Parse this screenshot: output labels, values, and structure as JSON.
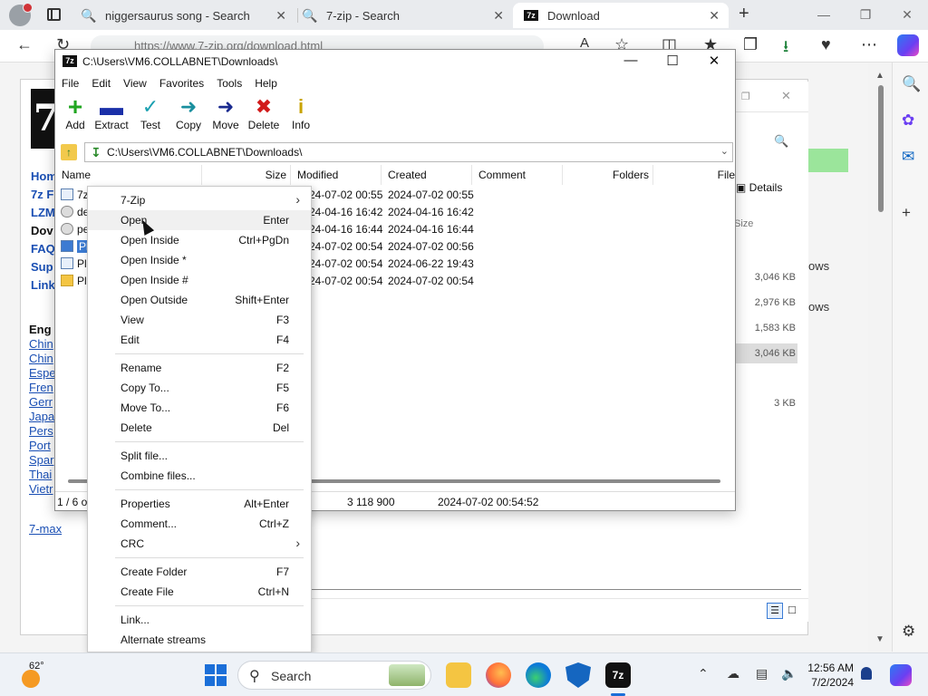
{
  "browser": {
    "tabs": [
      {
        "title": "niggersaurus song - Search",
        "icon": "bing-search-icon"
      },
      {
        "title": "7-zip - Search",
        "icon": "bing-search-icon"
      },
      {
        "title": "Download",
        "icon": "7zip-icon"
      }
    ],
    "url": "https://www.7-zip.org/download.html"
  },
  "webpage": {
    "nav": [
      "Hom",
      "7z F",
      "LZM",
      "Dov",
      "FAQ",
      "Sup",
      "Link"
    ],
    "lang_heading": "Eng",
    "languages": [
      "Chin",
      "Chin",
      "Espe",
      "Fren",
      "Gerr",
      "Japa",
      "Pers",
      "Port",
      "Spar",
      "Thai",
      "Vietr"
    ],
    "seven_max": "7-max"
  },
  "explorer_bg": {
    "details_label": "Details",
    "size_header": "Size",
    "sizes": [
      "3,046 KB",
      "2,976 KB",
      "1,583 KB",
      "3,046 KB",
      "3 KB"
    ],
    "row_fragments": [
      "ows",
      "ows"
    ]
  },
  "sevenzip": {
    "title": "C:\\Users\\VM6.COLLABNET\\Downloads\\",
    "menu": [
      "File",
      "Edit",
      "View",
      "Favorites",
      "Tools",
      "Help"
    ],
    "toolbar": [
      {
        "label": "Add",
        "icon": "add-icon",
        "color": "#21a621"
      },
      {
        "label": "Extract",
        "icon": "extract-icon",
        "color": "#1a2fa8"
      },
      {
        "label": "Test",
        "icon": "test-icon",
        "color": "#1aa0b0"
      },
      {
        "label": "Copy",
        "icon": "copy-icon",
        "color": "#1a8f9e"
      },
      {
        "label": "Move",
        "icon": "move-icon",
        "color": "#1a2a8f"
      },
      {
        "label": "Delete",
        "icon": "delete-icon",
        "color": "#d11a1a"
      },
      {
        "label": "Info",
        "icon": "info-icon",
        "color": "#c9a400"
      }
    ],
    "path": "C:\\Users\\VM6.COLLABNET\\Downloads\\",
    "columns": [
      "Name",
      "Size",
      "Modified",
      "Created",
      "Comment",
      "Folders",
      "File"
    ],
    "rows": [
      {
        "name": "7z",
        "modified": "24-07-02 00:55",
        "created": "2024-07-02 00:55",
        "kind": "file"
      },
      {
        "name": "de",
        "modified": "24-04-16 16:42",
        "created": "2024-04-16 16:42",
        "kind": "exe"
      },
      {
        "name": "pe",
        "modified": "24-04-16 16:44",
        "created": "2024-04-16 16:44",
        "kind": "exe"
      },
      {
        "name": "Pl",
        "modified": "24-07-02 00:54",
        "created": "2024-07-02 00:56",
        "kind": "file",
        "selected": true
      },
      {
        "name": "Pl",
        "modified": "24-07-02 00:54",
        "created": "2024-06-22 19:43",
        "kind": "file"
      },
      {
        "name": "Pl",
        "modified": "24-07-02 00:54",
        "created": "2024-07-02 00:54",
        "kind": "folder"
      }
    ],
    "status": {
      "count": "1 / 6 o",
      "size": "3 118 900",
      "date": "2024-07-02 00:54:52"
    }
  },
  "context_menu": [
    {
      "label": "7-Zip",
      "shortcut": "",
      "submenu": true
    },
    {
      "label": "Open",
      "shortcut": "Enter",
      "hot": true
    },
    {
      "label": "Open Inside",
      "shortcut": "Ctrl+PgDn"
    },
    {
      "label": "Open Inside *",
      "shortcut": ""
    },
    {
      "label": "Open Inside #",
      "shortcut": ""
    },
    {
      "label": "Open Outside",
      "shortcut": "Shift+Enter"
    },
    {
      "label": "View",
      "shortcut": "F3"
    },
    {
      "label": "Edit",
      "shortcut": "F4"
    },
    {
      "sep": true
    },
    {
      "label": "Rename",
      "shortcut": "F2"
    },
    {
      "label": "Copy To...",
      "shortcut": "F5"
    },
    {
      "label": "Move To...",
      "shortcut": "F6"
    },
    {
      "label": "Delete",
      "shortcut": "Del"
    },
    {
      "sep": true
    },
    {
      "label": "Split file...",
      "shortcut": ""
    },
    {
      "label": "Combine files...",
      "shortcut": ""
    },
    {
      "sep": true
    },
    {
      "label": "Properties",
      "shortcut": "Alt+Enter"
    },
    {
      "label": "Comment...",
      "shortcut": "Ctrl+Z"
    },
    {
      "label": "CRC",
      "shortcut": "",
      "submenu": true
    },
    {
      "sep": true
    },
    {
      "label": "Create Folder",
      "shortcut": "F7"
    },
    {
      "label": "Create File",
      "shortcut": "Ctrl+N"
    },
    {
      "sep": true
    },
    {
      "label": "Link...",
      "shortcut": ""
    },
    {
      "label": "Alternate streams",
      "shortcut": ""
    }
  ],
  "taskbar": {
    "temperature": "62°",
    "search_label": "Search",
    "time": "12:56 AM",
    "date": "7/2/2024"
  }
}
